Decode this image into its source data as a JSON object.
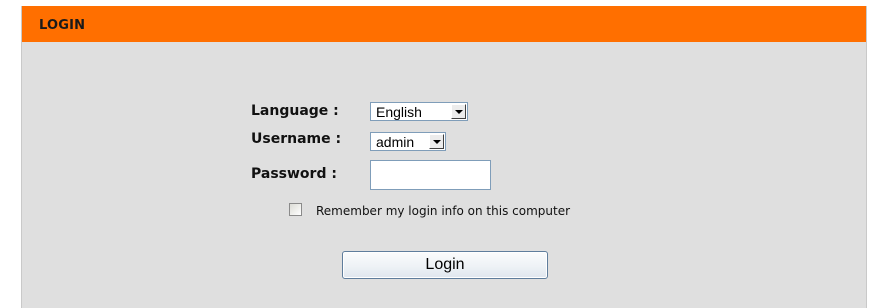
{
  "panel": {
    "title": "LOGIN",
    "header_color": "#ff6f00"
  },
  "form": {
    "language": {
      "label": "Language :",
      "selected": "English"
    },
    "username": {
      "label": "Username :",
      "selected": "admin"
    },
    "password": {
      "label": "Password :",
      "value": ""
    },
    "remember": {
      "label": "Remember my login info on this computer",
      "checked": false
    },
    "submit_label": "Login"
  },
  "icons": {
    "dropdown": "chevron-down-icon"
  }
}
